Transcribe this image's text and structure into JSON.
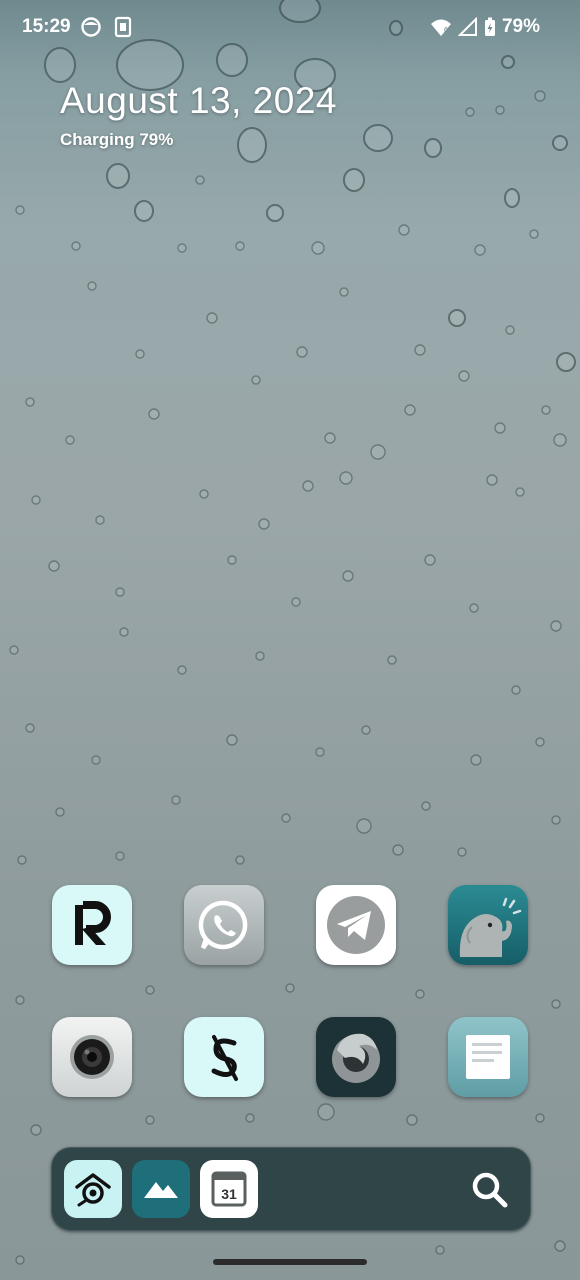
{
  "status_bar": {
    "time": "15:29",
    "battery_text": "79%",
    "icons": [
      "moon-face-icon",
      "sim-card-icon",
      "wifi-icon",
      "cellular-signal-icon",
      "battery-charging-icon"
    ]
  },
  "widget": {
    "date": "August 13, 2024",
    "charging": "Charging 79%"
  },
  "home_apps": [
    {
      "icon": "revolut-r-icon"
    },
    {
      "icon": "whatsapp-phone-icon"
    },
    {
      "icon": "telegram-plane-icon"
    },
    {
      "icon": "elephant-mastodon-icon"
    },
    {
      "icon": "camera-lens-icon"
    },
    {
      "icon": "slashed-s-icon"
    },
    {
      "icon": "firefox-fox-icon"
    },
    {
      "icon": "notes-page-icon"
    }
  ],
  "dock": {
    "apps": [
      {
        "icon": "home-eye-icon"
      },
      {
        "icon": "mountains-gallery-icon"
      },
      {
        "icon": "calendar-icon",
        "label": "31"
      }
    ],
    "search_icon": "search-icon"
  },
  "colors": {
    "dock_bg": "#2f4548",
    "mint_icon": "#d8f7f7",
    "teal_icon": "#1f6f7a",
    "dark_icon": "#1d3236"
  }
}
